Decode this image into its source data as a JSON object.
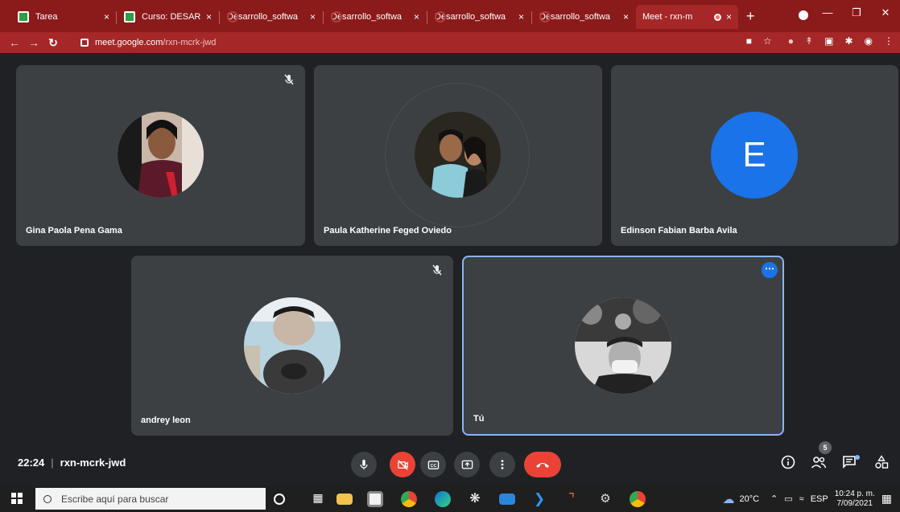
{
  "browser": {
    "tabs": [
      {
        "title": "Tarea"
      },
      {
        "title": "Curso: DESARROL"
      },
      {
        "title": "Desarrollo_softwa"
      },
      {
        "title": "Desarrollo_softwa"
      },
      {
        "title": "Desarrollo_softwa"
      },
      {
        "title": "Desarrollo_softwa"
      },
      {
        "title": "Meet - rxn-m"
      }
    ],
    "close_glyph": "×",
    "new_tab": "+",
    "url_host": "meet.google.com",
    "url_path": "/rxn-mcrk-jwd"
  },
  "meet": {
    "participants": [
      {
        "name": "Gina Paola Pena Gama",
        "muted": true
      },
      {
        "name": "Paula Katherine Feged Oviedo",
        "muted": false
      },
      {
        "name": "Edinson Fabian Barba Avila",
        "muted": false,
        "initial": "E"
      },
      {
        "name": "andrey leon",
        "muted": true
      },
      {
        "name": "Tú",
        "muted": false
      }
    ],
    "time": "22:24",
    "meeting_code": "rxn-mcrk-jwd",
    "participant_count": "5",
    "accent_color": "#1a73e8",
    "end_call_color": "#ea4335"
  },
  "taskbar": {
    "search_placeholder": "Escribe aquí para buscar",
    "weather": "20°C",
    "language": "ESP",
    "time": "10:24 p. m.",
    "date": "7/09/2021"
  }
}
